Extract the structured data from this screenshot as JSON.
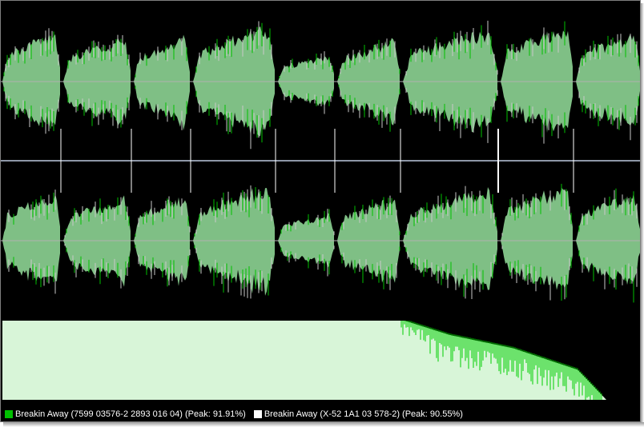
{
  "colors": {
    "background": "#000000",
    "centerline": "#b0b0b0",
    "divider": "#8e98a8",
    "waveform_fill": "#7fbf85",
    "waveform_peak_a": "#00c000",
    "waveform_peak_b": "#c9c9c9",
    "difference_fill": "#d8f5d8",
    "difference_peak": "#00d000",
    "marker": "#ffffff"
  },
  "waveform": {
    "channels": [
      "left",
      "right"
    ],
    "segment_boundaries": [
      0.0,
      0.095,
      0.205,
      0.297,
      0.43,
      0.523,
      0.625,
      0.778,
      0.895,
      1.0
    ],
    "segment_level": [
      0.72,
      0.64,
      0.66,
      0.8,
      0.4,
      0.62,
      0.76,
      0.82,
      0.72
    ],
    "track_markers": [
      0.095,
      0.205,
      0.297,
      0.43,
      0.523,
      0.625,
      0.778,
      0.895
    ],
    "lead_in_marker": 0.38
  },
  "difference_curve": {
    "description_points": [
      [
        0.0,
        1.0
      ],
      [
        0.63,
        1.0
      ],
      [
        0.7,
        0.82
      ],
      [
        0.8,
        0.65
      ],
      [
        0.9,
        0.38
      ],
      [
        0.945,
        0.0
      ]
    ]
  },
  "legend": {
    "items": [
      {
        "label": "Breakin Away (7599 03576-2 2893 016 04) (Peak: 91.91%)",
        "color": "#00c000"
      },
      {
        "label": "Breakin Away (X-52 1A1 03 578-2) (Peak: 90.55%)",
        "color": "#ffffff"
      }
    ]
  }
}
